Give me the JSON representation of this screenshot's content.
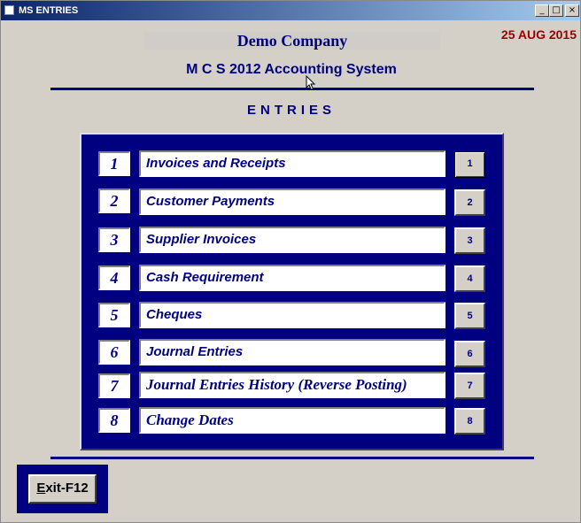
{
  "window": {
    "title": "MS ENTRIES",
    "controls": {
      "minimize": "_",
      "maximize": "□",
      "close": "×"
    }
  },
  "header": {
    "company": "Demo Company",
    "date": "25 AUG 2015",
    "system": "M C S 2012 Accounting System",
    "section": "ENTRIES"
  },
  "menu": {
    "items": [
      {
        "number": "1",
        "label": "Invoices and Receipts",
        "key": "1"
      },
      {
        "number": "2",
        "label": "Customer Payments",
        "key": "2"
      },
      {
        "number": "3",
        "label": "Supplier Invoices",
        "key": "3"
      },
      {
        "number": "4",
        "label": "Cash Requirement",
        "key": "4"
      },
      {
        "number": "5",
        "label": "Cheques",
        "key": "5"
      },
      {
        "number": "6",
        "label": "Journal Entries",
        "key": "6"
      },
      {
        "number": "7",
        "label": "Journal Entries History (Reverse Posting)",
        "key": "7"
      },
      {
        "number": "8",
        "label": "Change Dates",
        "key": "8"
      }
    ]
  },
  "footer": {
    "exit_mnemonic": "E",
    "exit_rest": "xit-F12"
  },
  "colors": {
    "navy": "#000080",
    "date": "#990000",
    "face": "#d4d0c8"
  }
}
